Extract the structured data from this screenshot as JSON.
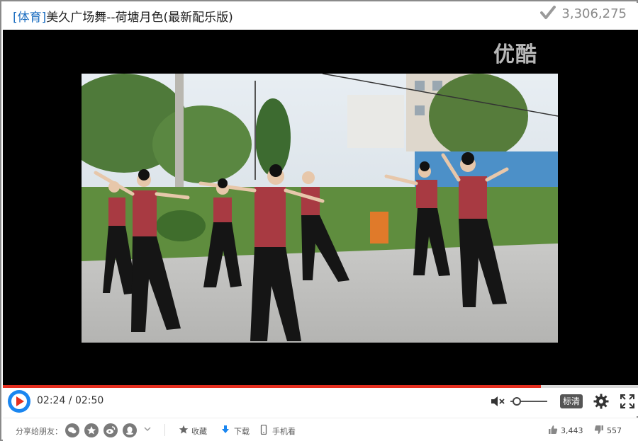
{
  "header": {
    "category": "[体育]",
    "title": "美久广场舞--荷塘月色(最新配乐版)",
    "views": "3,306,275"
  },
  "video": {
    "watermark": "优酷"
  },
  "player": {
    "current_time": "02:24",
    "separator": " / ",
    "duration": "02:50",
    "progress_fraction": 0.847,
    "volume_fraction": 0.08,
    "quality_label": "标清",
    "accent_color": "#e52e1f"
  },
  "share": {
    "label": "分享给朋友：",
    "icons": [
      "wechat-icon",
      "qzone-icon",
      "weibo-icon",
      "qq-icon"
    ],
    "favorite_label": "收藏",
    "download_label": "下载",
    "mobile_label": "手机看",
    "likes": "3,443",
    "dislikes": "557"
  }
}
